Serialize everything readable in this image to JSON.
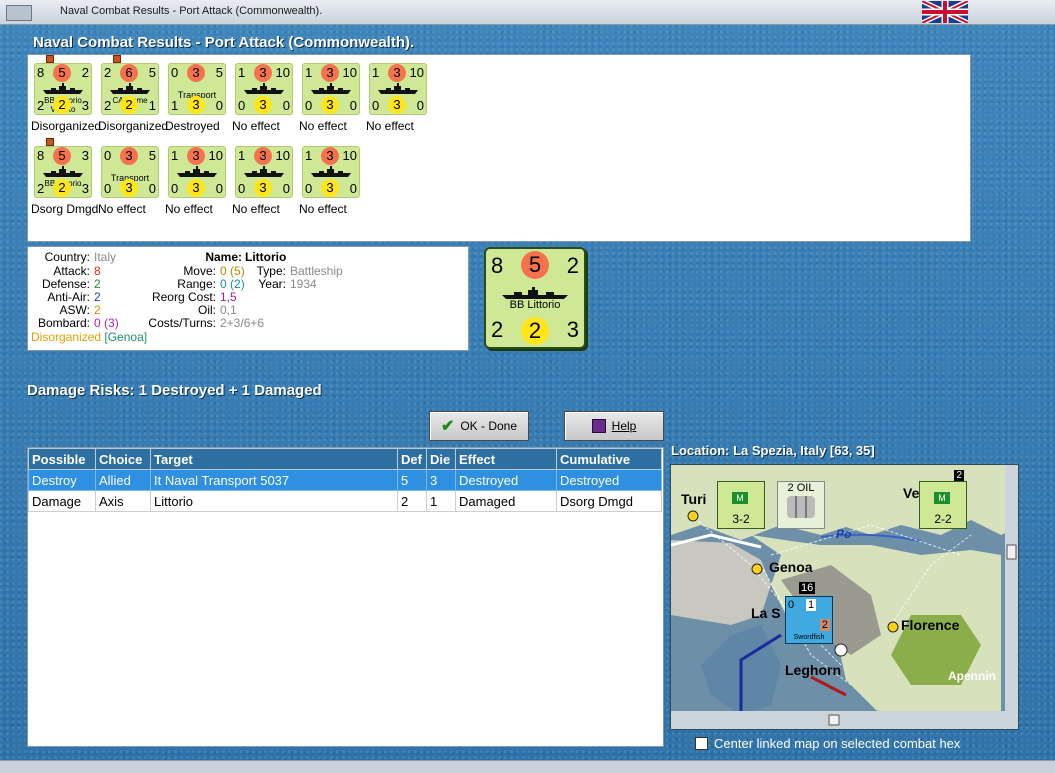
{
  "window": {
    "title": "Naval Combat Results - Port Attack (Commonwealth)."
  },
  "page_title": "Naval Combat Results - Port Attack (Commonwealth).",
  "counters_row1": [
    {
      "tl": "8",
      "top": "5",
      "tr": "2",
      "bl": "2",
      "bot": "2",
      "br": "3",
      "name": "BB Vittorio Veneto",
      "result": "Disorganized",
      "flag": true
    },
    {
      "tl": "2",
      "top": "6",
      "tr": "5",
      "bl": "2",
      "bot": "2",
      "br": "1",
      "name": "CA Fiume",
      "result": "Disorganized",
      "flag": true
    },
    {
      "tl": "0",
      "top": "3",
      "tr": "5",
      "bl": "1",
      "bot": "3",
      "br": "0",
      "name": "Transport",
      "result": "Destroyed",
      "flag": false
    },
    {
      "tl": "1",
      "top": "3",
      "tr": "10",
      "bl": "0",
      "bot": "3",
      "br": "0",
      "name": "",
      "result": "No effect",
      "flag": false
    },
    {
      "tl": "1",
      "top": "3",
      "tr": "10",
      "bl": "0",
      "bot": "3",
      "br": "0",
      "name": "",
      "result": "No effect",
      "flag": false
    },
    {
      "tl": "1",
      "top": "3",
      "tr": "10",
      "bl": "0",
      "bot": "3",
      "br": "0",
      "name": "",
      "result": "No effect",
      "flag": false
    }
  ],
  "counters_row2": [
    {
      "tl": "8",
      "top": "5",
      "tr": "3",
      "bl": "2",
      "bot": "2",
      "br": "3",
      "name": "BB Littorio",
      "result": "Dsorg Dmgd",
      "flag": true
    },
    {
      "tl": "0",
      "top": "3",
      "tr": "5",
      "bl": "0",
      "bot": "3",
      "br": "0",
      "name": "Transport",
      "result": "No effect",
      "flag": false
    },
    {
      "tl": "1",
      "top": "3",
      "tr": "10",
      "bl": "0",
      "bot": "3",
      "br": "0",
      "name": "",
      "result": "No effect",
      "flag": false
    },
    {
      "tl": "1",
      "top": "3",
      "tr": "10",
      "bl": "0",
      "bot": "3",
      "br": "0",
      "name": "",
      "result": "No effect",
      "flag": false
    },
    {
      "tl": "1",
      "top": "3",
      "tr": "10",
      "bl": "0",
      "bot": "3",
      "br": "0",
      "name": "",
      "result": "No effect",
      "flag": false
    }
  ],
  "info": {
    "country_label": "Country:",
    "country": "Italy",
    "attack_label": "Attack:",
    "attack": "8",
    "defense_label": "Defense:",
    "defense": "2",
    "antiair_label": "Anti-Air:",
    "antiair": "2",
    "asw_label": "ASW:",
    "asw": "2",
    "bombard_label": "Bombard:",
    "bombard": "0",
    "bombard_paren": "(3)",
    "name_label": "Name:",
    "name": "Littorio",
    "move_label": "Move:",
    "move": "0",
    "move_paren": "(5)",
    "type_label": "Type:",
    "type": "Battleship",
    "range_label": "Range:",
    "range": "0",
    "range_paren": "(2)",
    "year_label": "Year:",
    "year": "1934",
    "reorg_label": "Reorg Cost:",
    "reorg": "1,5",
    "oil_label": "Oil:",
    "oil": "0,1",
    "costs_label": "Costs/Turns:",
    "costs": "2+3/6+6",
    "status": "Disorganized",
    "location": "[Genoa]"
  },
  "big_counter": {
    "tl": "8",
    "top": "5",
    "tr": "2",
    "bl": "2",
    "bot": "2",
    "br": "3",
    "name": "BB Littorio"
  },
  "damage_risks": "Damage Risks: 1 Destroyed + 1 Damaged",
  "buttons": {
    "ok": "OK - Done",
    "help": "Help"
  },
  "table": {
    "headers": [
      "Possible",
      "Choice",
      "Target",
      "Def",
      "Die",
      "Effect",
      "Cumulative"
    ],
    "rows": [
      [
        "Destroy",
        "Allied",
        "It Naval Transport 5037",
        "5",
        "3",
        "Destroyed",
        "Destroyed"
      ],
      [
        "Damage",
        "Axis",
        "Littorio",
        "2",
        "1",
        "Damaged",
        "Dsorg Dmgd"
      ]
    ]
  },
  "location": "Location:  La Spezia, Italy [63, 35]",
  "map": {
    "cities": [
      "Turin",
      "Venice",
      "Genoa",
      "La Spezia",
      "Florence",
      "Leghorn",
      "Apennines"
    ],
    "labels": {
      "turin": "Turi",
      "venice": "Ve",
      "genoa": "Genoa",
      "spezia": "La S",
      "florence": "Florence",
      "leghorn": "Leghorn",
      "apennines": "Apennin",
      "po": "Po"
    },
    "units": {
      "left_name": "Turin",
      "left_val": "3-2",
      "oil": "2 OIL",
      "right_name": "Venice",
      "right_val": "2-2",
      "right_badge": "2",
      "stack_count": "16",
      "swordfish": "Swordfish",
      "sw_a": "0",
      "sw_b": "1",
      "sw_c": "2"
    }
  },
  "center_label": "Center linked map on selected combat hex"
}
